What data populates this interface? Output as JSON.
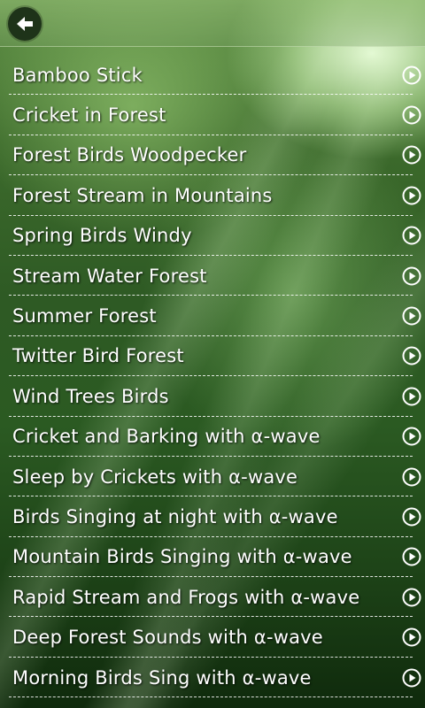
{
  "header": {
    "back_icon": "back-arrow-icon"
  },
  "items": [
    {
      "title": "Bamboo Stick"
    },
    {
      "title": "Cricket in Forest"
    },
    {
      "title": "Forest Birds Woodpecker"
    },
    {
      "title": "Forest Stream in Mountains"
    },
    {
      "title": "Spring Birds Windy"
    },
    {
      "title": "Stream Water Forest"
    },
    {
      "title": "Summer Forest"
    },
    {
      "title": "Twitter Bird Forest"
    },
    {
      "title": "Wind Trees Birds"
    },
    {
      "title": "Cricket and Barking with α-wave"
    },
    {
      "title": "Sleep by Crickets with α-wave"
    },
    {
      "title": "Birds Singing at night with α-wave"
    },
    {
      "title": "Mountain Birds Singing with α-wave"
    },
    {
      "title": "Rapid Stream and Frogs with α-wave"
    },
    {
      "title": "Deep Forest Sounds with α-wave"
    },
    {
      "title": "Morning Birds Sing with α-wave"
    }
  ],
  "colors": {
    "text": "#ffffff",
    "divider": "#ffffff",
    "back_button": "#1e3319"
  },
  "item_icon": "play-circle-icon"
}
